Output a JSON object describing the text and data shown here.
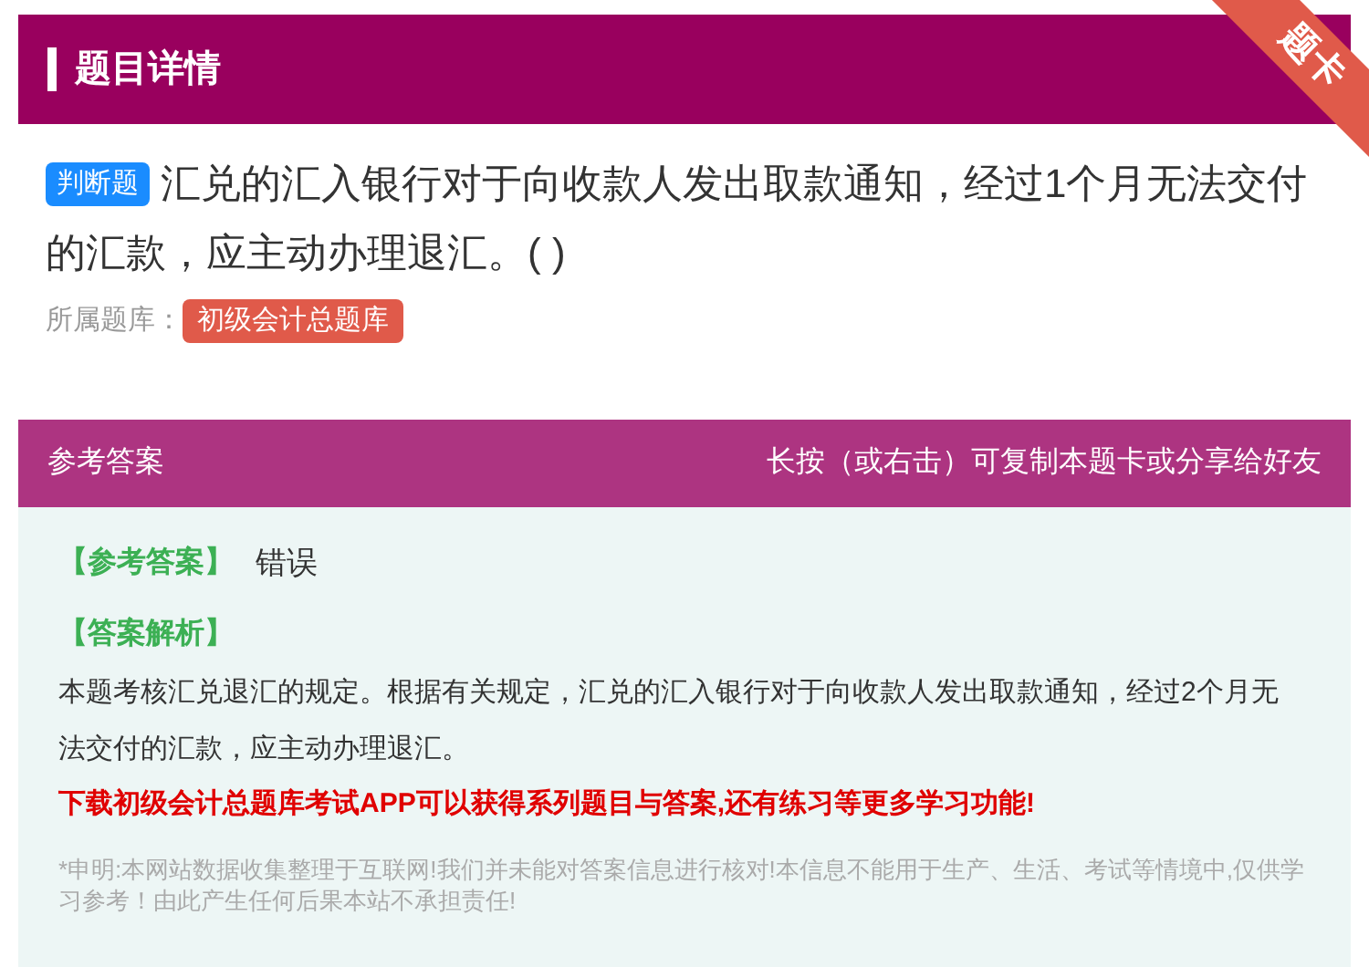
{
  "header": {
    "title": "题目详情",
    "ribbon": "题卡"
  },
  "question": {
    "type_badge": "判断题",
    "text": "汇兑的汇入银行对于向收款人发出取款通知，经过1个月无法交付的汇款，应主动办理退汇。( )",
    "library_label": "所属题库：",
    "library": "初级会计总题库"
  },
  "answer_panel": {
    "title": "参考答案",
    "hint": "长按（或右击）可复制本题卡或分享给好友",
    "answer_label": "【参考答案】",
    "answer": "错误",
    "analysis_label": "【答案解析】",
    "analysis": "本题考核汇兑退汇的规定。根据有关规定，汇兑的汇入银行对于向收款人发出取款通知，经过2个月无法交付的汇款，应主动办理退汇。",
    "promo": "下载初级会计总题库考试APP可以获得系列题目与答案,还有练习等更多学习功能!",
    "disclaimer": "*申明:本网站数据收集整理于互联网!我们并未能对答案信息进行核对!本信息不能用于生产、生活、考试等情境中,仅供学习参考！由此产生任何后果本站不承担责任!"
  }
}
